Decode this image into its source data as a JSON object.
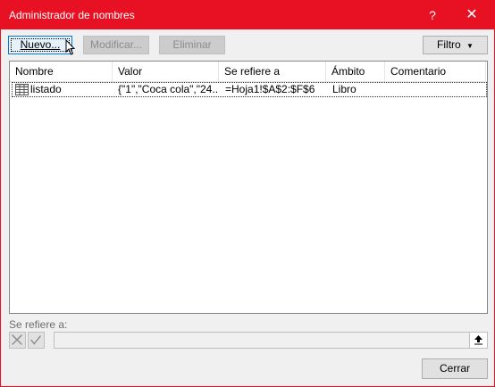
{
  "window": {
    "title": "Administrador de nombres",
    "help": "?",
    "close": "✕"
  },
  "toolbar": {
    "new_label": "Nuevo...",
    "edit_label": "Modificar...",
    "delete_label": "Eliminar",
    "filter_label": "Filtro"
  },
  "table": {
    "headers": [
      "Nombre",
      "Valor",
      "Se refiere a",
      "Ámbito",
      "Comentario"
    ],
    "rows": [
      {
        "name": "listado",
        "value": "{\"1\",\"Coca cola\",\"24...",
        "refers_to": "=Hoja1!$A$2:$F$6",
        "scope": "Libro",
        "comment": ""
      }
    ]
  },
  "refers_section": {
    "label": "Se refiere a:",
    "value": ""
  },
  "footer": {
    "close_label": "Cerrar"
  }
}
